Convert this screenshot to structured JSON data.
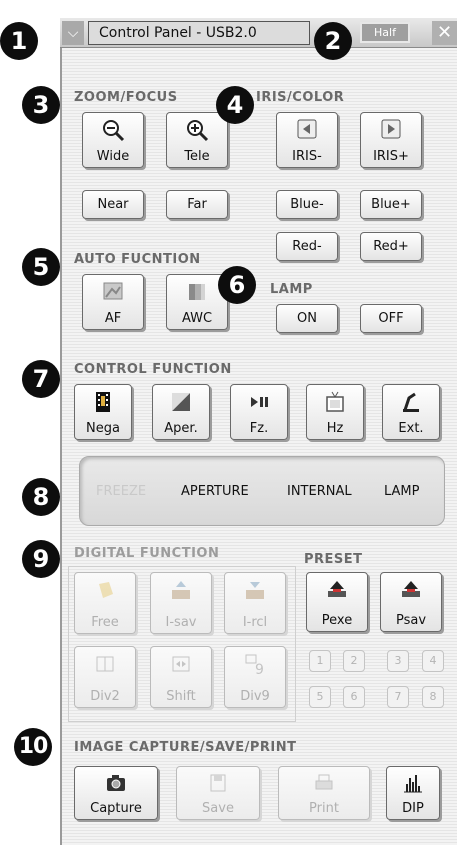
{
  "titlebar": {
    "dropdown_glyph": "⌵",
    "title": "Control Panel - USB2.0",
    "half_label": "Half",
    "close_glyph": "✕"
  },
  "callouts": [
    "1",
    "2",
    "3",
    "4",
    "5",
    "6",
    "7",
    "8",
    "9",
    "10"
  ],
  "zoom_focus": {
    "header": "ZOOM/FOCUS",
    "wide": "Wide",
    "tele": "Tele",
    "near": "Near",
    "far": "Far"
  },
  "iris_color": {
    "header": "IRIS/COLOR",
    "iris_minus": "IRIS-",
    "iris_plus": "IRIS+",
    "blue_minus": "Blue-",
    "blue_plus": "Blue+",
    "red_minus": "Red-",
    "red_plus": "Red+"
  },
  "auto_function": {
    "header": "AUTO FUCNTION",
    "af": "AF",
    "awc": "AWC"
  },
  "lamp": {
    "header": "LAMP",
    "on": "ON",
    "off": "OFF"
  },
  "control_function": {
    "header": "CONTROL FUNCTION",
    "nega": "Nega",
    "aper": "Aper.",
    "fz": "Fz.",
    "hz": "Hz",
    "ext": "Ext."
  },
  "status": {
    "freeze": "FREEZE",
    "aperture": "APERTURE",
    "internal": "INTERNAL",
    "lamp": "LAMP"
  },
  "digital_function": {
    "header": "DIGITAL FUNCTION",
    "free": "Free",
    "isav": "I-sav",
    "ircl": "I-rcl",
    "div2": "Div2",
    "shift": "Shift",
    "div9": "Div9"
  },
  "preset": {
    "header": "PRESET",
    "pexe": "Pexe",
    "psav": "Psav",
    "numbers": [
      "1",
      "2",
      "3",
      "4",
      "5",
      "6",
      "7",
      "8"
    ]
  },
  "capture": {
    "header": "IMAGE CAPTURE/SAVE/PRINT",
    "capture": "Capture",
    "save": "Save",
    "print": "Print",
    "dip": "DIP"
  }
}
